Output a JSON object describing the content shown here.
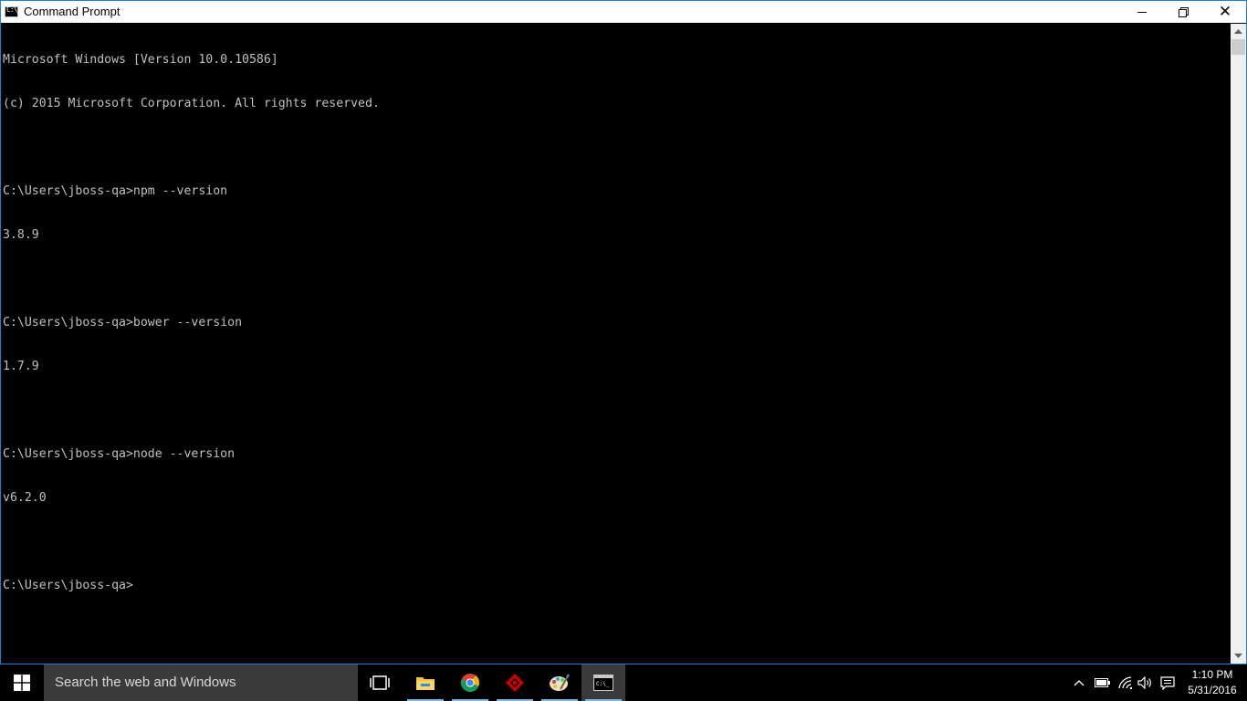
{
  "window": {
    "title": "Command Prompt",
    "icon": "cmd-icon",
    "icon_text": "C:\\_",
    "close_glyph": "✕"
  },
  "console": {
    "lines": [
      "Microsoft Windows [Version 10.0.10586]",
      "(c) 2015 Microsoft Corporation. All rights reserved.",
      "",
      "C:\\Users\\jboss-qa>npm --version",
      "3.8.9",
      "",
      "C:\\Users\\jboss-qa>bower --version",
      "1.7.9",
      "",
      "C:\\Users\\jboss-qa>node --version",
      "v6.2.0",
      "",
      "C:\\Users\\jboss-qa>"
    ],
    "text_color": "#c0c0c0",
    "background": "#000000"
  },
  "taskbar": {
    "search_placeholder": "Search the web and Windows",
    "apps": [
      {
        "name": "task-view-icon"
      },
      {
        "name": "file-explorer-icon"
      },
      {
        "name": "chrome-icon"
      },
      {
        "name": "openshift-icon"
      },
      {
        "name": "paint-icon"
      },
      {
        "name": "command-prompt-icon"
      }
    ],
    "tray": {
      "icons": [
        "chevron-up-icon",
        "battery-icon",
        "wifi-icon",
        "volume-icon",
        "notifications-icon"
      ]
    },
    "clock": {
      "time": "1:10 PM",
      "date": "5/31/2016"
    }
  },
  "colors": {
    "accent": "#1f7fd6",
    "taskbar_running": "#76b9ed"
  }
}
